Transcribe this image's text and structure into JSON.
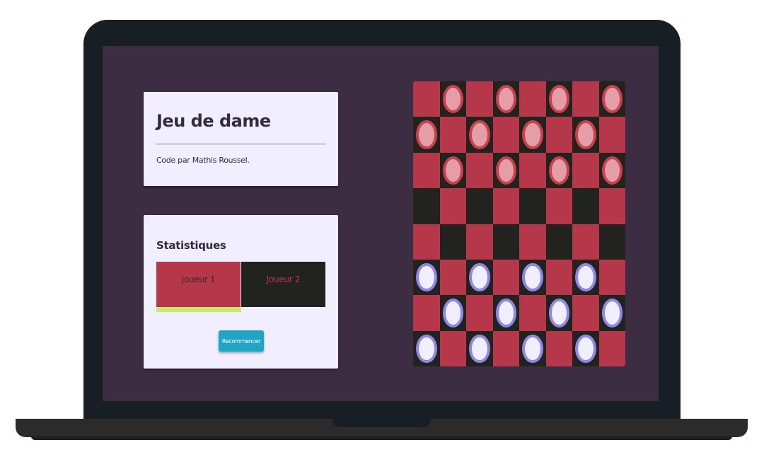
{
  "info_panel": {
    "title": "Jeu de dame",
    "credit": "Code par Mathis Roussel."
  },
  "stats_panel": {
    "title": "Statistiques",
    "players": [
      {
        "label": "Joueur 1",
        "active": true
      },
      {
        "label": "Joueur 2",
        "active": false
      }
    ],
    "restart_label": "Recommencer"
  },
  "board": {
    "rows": 8,
    "cols": 8,
    "pieces": [
      ".r.r.r.r",
      "r.r.r.r.",
      ".r.r.r.r",
      "........",
      "........",
      "b.b.b.b.",
      ".b.b.b.b",
      "b.b.b.b."
    ],
    "legend": {
      "r": "red",
      "b": "blue"
    }
  },
  "colors": {
    "background": "#3d2d42",
    "panel": "#f0eeff",
    "light_square": "#b7374a",
    "dark_square": "#22221f",
    "red_piece_fill": "#e49fa6",
    "red_piece_ring": "#c9404f",
    "blue_piece_fill": "#f0eeff",
    "blue_piece_ring": "#8d88e6",
    "turn_indicator": "#c2ee68",
    "button": "#1fa6c7"
  }
}
